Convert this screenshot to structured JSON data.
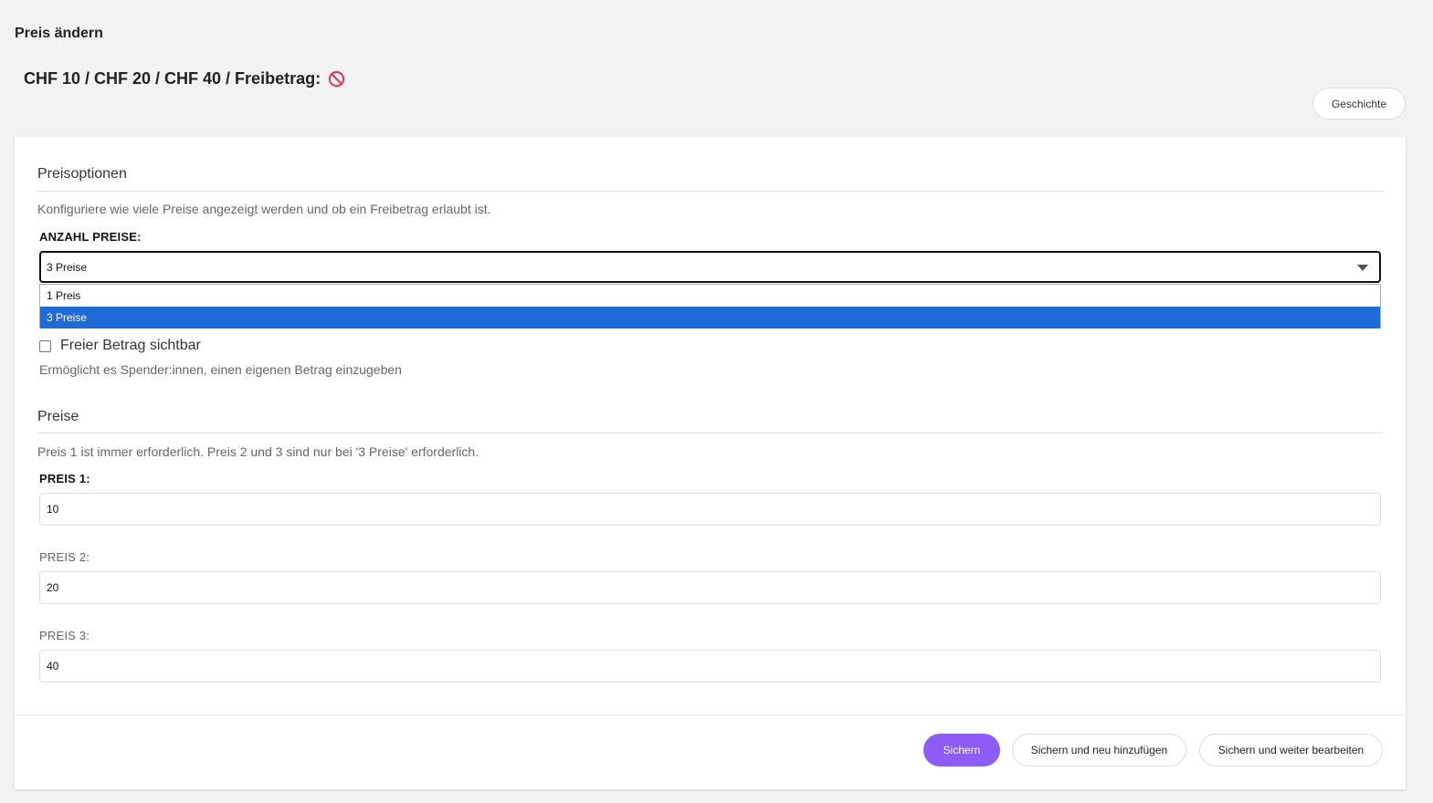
{
  "page": {
    "heading": "Preis ändern",
    "object_title": "CHF 10 / CHF 20 / CHF 40 / Freibetrag:",
    "object_status_icon": "no-entry-icon",
    "history_button": "Geschichte"
  },
  "options_section": {
    "title": "Preisoptionen",
    "help": "Konfiguriere wie viele Preise angezeigt werden und ob ein Freibetrag erlaubt ist.",
    "count_label": "ANZAHL PREISE:",
    "count_value": "3 Preise",
    "count_options": [
      "1 Preis",
      "3 Preise"
    ],
    "free_amount_label": "Freier Betrag sichtbar",
    "free_amount_checked": false,
    "free_amount_help": "Ermöglicht es Spender:innen, einen eigenen Betrag einzugeben"
  },
  "prices_section": {
    "title": "Preise",
    "help": "Preis 1 ist immer erforderlich. Preis 2 und 3 sind nur bei '3 Preise' erforderlich.",
    "price1_label": "PREIS 1:",
    "price1_value": "10",
    "price2_label": "PREIS 2:",
    "price2_value": "20",
    "price3_label": "PREIS 3:",
    "price3_value": "40"
  },
  "actions": {
    "save": "Sichern",
    "save_add": "Sichern und neu hinzufügen",
    "save_continue": "Sichern und weiter bearbeiten"
  },
  "colors": {
    "primary": "#8b5cf6",
    "selected_option": "#1e6bd6",
    "no_icon": "#e8385a"
  }
}
